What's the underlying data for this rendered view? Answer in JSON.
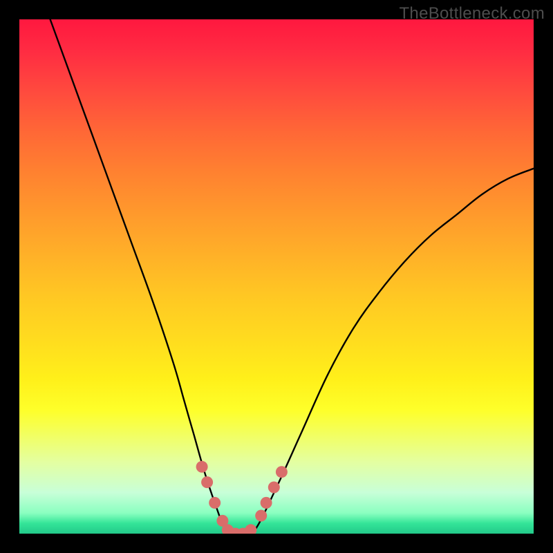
{
  "watermark": "TheBottleneck.com",
  "chart_data": {
    "type": "line",
    "title": "",
    "xlabel": "",
    "ylabel": "",
    "xlim": [
      0,
      100
    ],
    "ylim": [
      0,
      100
    ],
    "series": [
      {
        "name": "bottleneck-curve",
        "x": [
          6,
          10,
          14,
          18,
          22,
          26,
          30,
          32,
          34,
          36,
          38,
          40,
          42,
          44,
          46,
          50,
          55,
          60,
          65,
          70,
          75,
          80,
          85,
          90,
          95,
          100
        ],
        "y": [
          100,
          89,
          78,
          67,
          56,
          45,
          33,
          26,
          19,
          12,
          6,
          1,
          0,
          0,
          1,
          9,
          20,
          31,
          40,
          47,
          53,
          58,
          62,
          66,
          69,
          71
        ]
      }
    ],
    "markers": {
      "name": "highlight-dots",
      "color": "#d96d6a",
      "points": [
        {
          "x": 35.5,
          "y": 13
        },
        {
          "x": 36.5,
          "y": 10
        },
        {
          "x": 38.0,
          "y": 6
        },
        {
          "x": 39.5,
          "y": 2.5
        },
        {
          "x": 40.5,
          "y": 0.7
        },
        {
          "x": 42.0,
          "y": 0
        },
        {
          "x": 43.5,
          "y": 0
        },
        {
          "x": 45.0,
          "y": 0.7
        },
        {
          "x": 47.0,
          "y": 3.5
        },
        {
          "x": 48.0,
          "y": 6
        },
        {
          "x": 49.5,
          "y": 9
        },
        {
          "x": 51.0,
          "y": 12
        }
      ]
    },
    "gradient_stops": [
      {
        "pos": 0,
        "color": "#ff183f"
      },
      {
        "pos": 50,
        "color": "#ffb828"
      },
      {
        "pos": 76,
        "color": "#fff51c"
      },
      {
        "pos": 100,
        "color": "#22c98a"
      }
    ]
  }
}
